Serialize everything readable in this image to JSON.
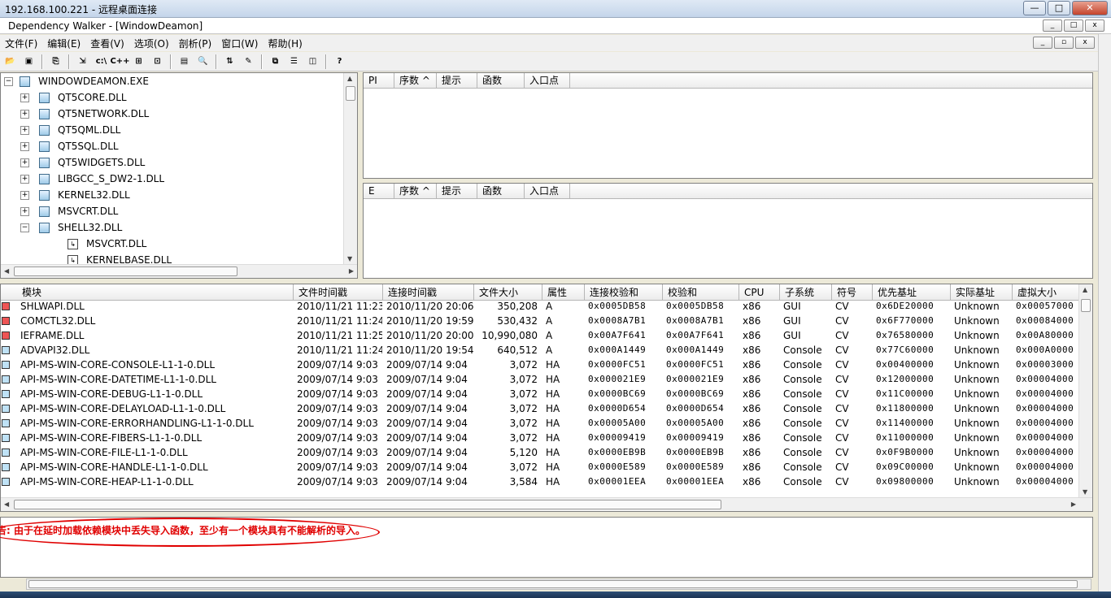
{
  "rdp": {
    "title": "192.168.100.221 - 远程桌面连接",
    "min": "—",
    "max": "□",
    "close": "✕"
  },
  "app": {
    "title": "Dependency Walker - [WindowDeamon]"
  },
  "menu": [
    "文件(F)",
    "编辑(E)",
    "查看(V)",
    "选项(O)",
    "剖析(P)",
    "窗口(W)",
    "帮助(H)"
  ],
  "toolbar": {
    "c_drive": "c:\\",
    "cpp": "C++",
    "help": "?"
  },
  "tree": {
    "root": "WINDOWDEAMON.EXE",
    "items": [
      {
        "label": "QT5CORE.DLL"
      },
      {
        "label": "QT5NETWORK.DLL"
      },
      {
        "label": "QT5QML.DLL"
      },
      {
        "label": "QT5SQL.DLL"
      },
      {
        "label": "QT5WIDGETS.DLL"
      },
      {
        "label": "LIBGCC_S_DW2-1.DLL"
      },
      {
        "label": "KERNEL32.DLL"
      },
      {
        "label": "MSVCRT.DLL"
      },
      {
        "label": "SHELL32.DLL"
      }
    ],
    "children": [
      {
        "label": "MSVCRT.DLL"
      },
      {
        "label": "KERNELBASE.DLL"
      }
    ]
  },
  "import_pane": {
    "headers": [
      "PI",
      "序数 ^",
      "提示",
      "函数",
      "入口点"
    ]
  },
  "export_pane": {
    "headers": [
      "E",
      "序数 ^",
      "提示",
      "函数",
      "入口点"
    ]
  },
  "module_headers": [
    "模块",
    "文件时间戳",
    "连接时间戳",
    "文件大小",
    "属性",
    "连接校验和",
    "校验和",
    "CPU",
    "子系统",
    "符号",
    "优先基址",
    "实际基址",
    "虚拟大小"
  ],
  "modules": [
    [
      "SHLWAPI.DLL",
      "2010/11/21 11:23",
      "2010/11/20 20:06",
      "350,208",
      "A",
      "0x0005DB58",
      "0x0005DB58",
      "x86",
      "GUI",
      "CV",
      "0x6DE20000",
      "Unknown",
      "0x00057000"
    ],
    [
      "COMCTL32.DLL",
      "2010/11/21 11:24",
      "2010/11/20 19:59",
      "530,432",
      "A",
      "0x0008A7B1",
      "0x0008A7B1",
      "x86",
      "GUI",
      "CV",
      "0x6F770000",
      "Unknown",
      "0x00084000"
    ],
    [
      "IEFRAME.DLL",
      "2010/11/21 11:25",
      "2010/11/20 20:00",
      "10,990,080",
      "A",
      "0x00A7F641",
      "0x00A7F641",
      "x86",
      "GUI",
      "CV",
      "0x76580000",
      "Unknown",
      "0x00A80000"
    ],
    [
      "ADVAPI32.DLL",
      "2010/11/21 11:24",
      "2010/11/20 19:54",
      "640,512",
      "A",
      "0x000A1449",
      "0x000A1449",
      "x86",
      "Console",
      "CV",
      "0x77C60000",
      "Unknown",
      "0x000A0000"
    ],
    [
      "API-MS-WIN-CORE-CONSOLE-L1-1-0.DLL",
      "2009/07/14   9:03",
      "2009/07/14   9:04",
      "3,072",
      "HA",
      "0x0000FC51",
      "0x0000FC51",
      "x86",
      "Console",
      "CV",
      "0x00400000",
      "Unknown",
      "0x00003000"
    ],
    [
      "API-MS-WIN-CORE-DATETIME-L1-1-0.DLL",
      "2009/07/14   9:03",
      "2009/07/14   9:04",
      "3,072",
      "HA",
      "0x000021E9",
      "0x000021E9",
      "x86",
      "Console",
      "CV",
      "0x12000000",
      "Unknown",
      "0x00004000"
    ],
    [
      "API-MS-WIN-CORE-DEBUG-L1-1-0.DLL",
      "2009/07/14   9:03",
      "2009/07/14   9:04",
      "3,072",
      "HA",
      "0x0000BC69",
      "0x0000BC69",
      "x86",
      "Console",
      "CV",
      "0x11C00000",
      "Unknown",
      "0x00004000"
    ],
    [
      "API-MS-WIN-CORE-DELAYLOAD-L1-1-0.DLL",
      "2009/07/14   9:03",
      "2009/07/14   9:04",
      "3,072",
      "HA",
      "0x0000D654",
      "0x0000D654",
      "x86",
      "Console",
      "CV",
      "0x11800000",
      "Unknown",
      "0x00004000"
    ],
    [
      "API-MS-WIN-CORE-ERRORHANDLING-L1-1-0.DLL",
      "2009/07/14   9:03",
      "2009/07/14   9:04",
      "3,072",
      "HA",
      "0x00005A00",
      "0x00005A00",
      "x86",
      "Console",
      "CV",
      "0x11400000",
      "Unknown",
      "0x00004000"
    ],
    [
      "API-MS-WIN-CORE-FIBERS-L1-1-0.DLL",
      "2009/07/14   9:03",
      "2009/07/14   9:04",
      "3,072",
      "HA",
      "0x00009419",
      "0x00009419",
      "x86",
      "Console",
      "CV",
      "0x11000000",
      "Unknown",
      "0x00004000"
    ],
    [
      "API-MS-WIN-CORE-FILE-L1-1-0.DLL",
      "2009/07/14   9:03",
      "2009/07/14   9:04",
      "5,120",
      "HA",
      "0x0000EB9B",
      "0x0000EB9B",
      "x86",
      "Console",
      "CV",
      "0x0F9B0000",
      "Unknown",
      "0x00004000"
    ],
    [
      "API-MS-WIN-CORE-HANDLE-L1-1-0.DLL",
      "2009/07/14   9:03",
      "2009/07/14   9:04",
      "3,072",
      "HA",
      "0x0000E589",
      "0x0000E589",
      "x86",
      "Console",
      "CV",
      "0x09C00000",
      "Unknown",
      "0x00004000"
    ],
    [
      "API-MS-WIN-CORE-HEAP-L1-1-0.DLL",
      "2009/07/14   9:03",
      "2009/07/14   9:04",
      "3,584",
      "HA",
      "0x00001EEA",
      "0x00001EEA",
      "x86",
      "Console",
      "CV",
      "0x09800000",
      "Unknown",
      "0x00004000"
    ]
  ],
  "module_status": [
    "err",
    "err",
    "err",
    "ok",
    "ok",
    "ok",
    "ok",
    "ok",
    "ok",
    "ok",
    "ok",
    "ok",
    "ok"
  ],
  "log": {
    "message": "告: 由于在延时加载依赖模块中丢失导入函数，至少有一个模块具有不能解析的导入。"
  },
  "colors": {
    "error_red": "#e00000",
    "window_bg": "#f0f0f0"
  }
}
